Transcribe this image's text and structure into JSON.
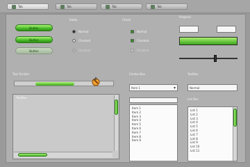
{
  "tabs": [
    {
      "label": "Tab",
      "icon": "window-icon",
      "active": true
    },
    {
      "label": "Tab",
      "icon": "window-icon",
      "active": false
    },
    {
      "label": "Tab",
      "icon": "window-icon",
      "active": false
    },
    {
      "label": "Tab",
      "icon": "window-icon",
      "active": false
    }
  ],
  "buttons": {
    "primary": "Button",
    "secondary": "Button",
    "disabled": "Button"
  },
  "radios": {
    "title": "Radio",
    "items": [
      {
        "label": "Normal",
        "state": "selected"
      },
      {
        "label": "Checked",
        "state": "normal"
      },
      {
        "label": "Disabled",
        "state": "disabled"
      }
    ]
  },
  "checks": {
    "title": "Check",
    "items": [
      {
        "label": "Normal",
        "state": "checked"
      },
      {
        "label": "Checked",
        "state": "checked"
      },
      {
        "label": "Disabled",
        "state": "disabled"
      }
    ]
  },
  "progress": {
    "title": "Progress",
    "field_a": "",
    "field_b": "",
    "bar_fraction": 1.0,
    "slider_fraction": 0.62
  },
  "scroll_section": {
    "title": "Text Scroller",
    "fill_fraction": 0.4
  },
  "text_area": {
    "title": "TextBox"
  },
  "combo": {
    "title": "Combo Box",
    "value": "Item 1"
  },
  "items_list": [
    "Item 1",
    "Item 2",
    "Item 3",
    "Item 4",
    "Item 5",
    "Item 6",
    "Item 7",
    "Item 8",
    "Item 9"
  ],
  "textbox": {
    "title": "TextBox",
    "value": "Normal"
  },
  "listbox": {
    "title": "List Box",
    "items": [
      "List 1",
      "List 2",
      "List 3",
      "List 4",
      "List 5",
      "List 6",
      "List 7",
      "List 8",
      "List 9",
      "List 10",
      "List 11"
    ]
  },
  "colors": {
    "accent": "#4cbe2a",
    "background": "#9a9a9a"
  }
}
